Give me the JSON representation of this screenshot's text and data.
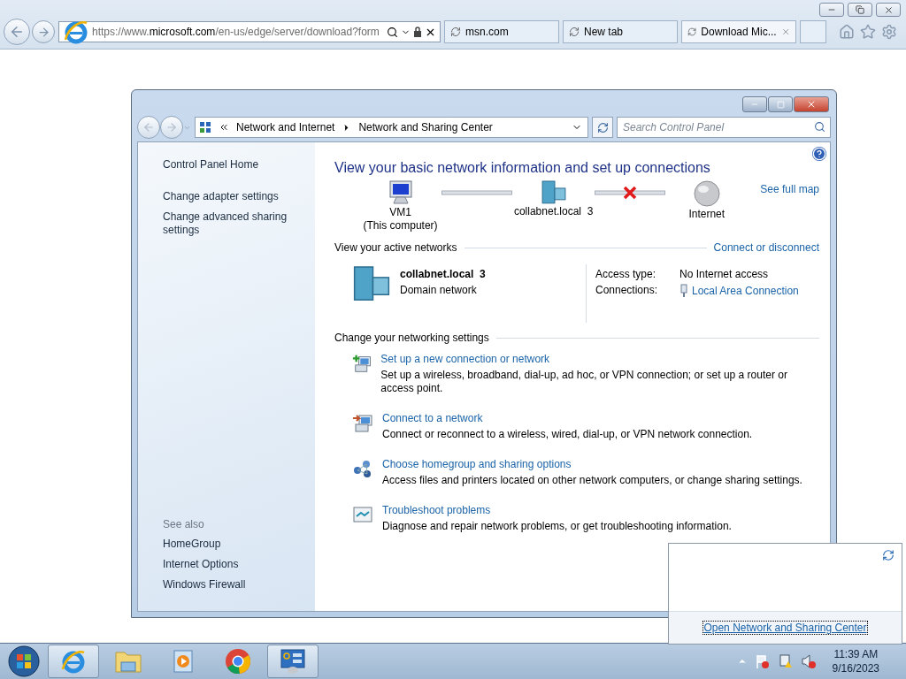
{
  "browser": {
    "address": {
      "prefix": "https://www.",
      "domain": "microsoft.com",
      "path": "/en-us/edge/server/download?form"
    },
    "tabs": [
      {
        "label": "msn.com",
        "selected": false,
        "closable": false
      },
      {
        "label": "New tab",
        "selected": false,
        "closable": false
      },
      {
        "label": "Download Mic...",
        "selected": true,
        "closable": true
      }
    ]
  },
  "window": {
    "breadcrumb": [
      "Network and Internet",
      "Network and Sharing Center"
    ],
    "search": {
      "placeholder": "Search Control Panel"
    },
    "sidebar": {
      "links": [
        "Control Panel Home",
        "Change adapter settings",
        "Change advanced sharing settings"
      ],
      "see_also_heading": "See also",
      "see_also": [
        "HomeGroup",
        "Internet Options",
        "Windows Firewall"
      ]
    },
    "heading": "View your basic network information and set up connections",
    "map": {
      "nodes": [
        {
          "kind": "computer",
          "label": "VM1",
          "sublabel": "(This computer)"
        },
        {
          "kind": "network",
          "label": "collabnet.local  3"
        },
        {
          "kind": "internet",
          "label": "Internet"
        }
      ],
      "links": [
        {
          "broken": false
        },
        {
          "broken": true
        }
      ],
      "full_map_link": "See full map"
    },
    "active_networks": {
      "heading": "View your active networks",
      "link": "Connect or disconnect",
      "networks": [
        {
          "name": "collabnet.local  3",
          "type": "Domain network",
          "access_label": "Access type:",
          "access": "No Internet access",
          "connections_label": "Connections:",
          "connection": "Local Area Connection"
        }
      ]
    },
    "settings": {
      "heading": "Change your networking settings",
      "tasks": [
        {
          "kind": "new-connection",
          "title": "Set up a new connection or network",
          "description": "Set up a wireless, broadband, dial-up, ad hoc, or VPN connection; or set up a router or access point."
        },
        {
          "kind": "connect",
          "title": "Connect to a network",
          "description": "Connect or reconnect to a wireless, wired, dial-up, or VPN network connection."
        },
        {
          "kind": "homegroup",
          "title": "Choose homegroup and sharing options",
          "description": "Access files and printers located on other network computers, or change sharing settings."
        },
        {
          "kind": "troubleshoot",
          "title": "Troubleshoot problems",
          "description": "Diagnose and repair network problems, or get troubleshooting information."
        }
      ]
    }
  },
  "flyout": {
    "link": "Open Network and Sharing Center"
  },
  "taskbar": {
    "apps": [
      {
        "kind": "ie",
        "running": true
      },
      {
        "kind": "explorer",
        "running": false
      },
      {
        "kind": "media",
        "running": false
      },
      {
        "kind": "chrome",
        "running": false
      },
      {
        "kind": "control-panel",
        "running": true
      }
    ],
    "time": "11:39 AM",
    "date": "9/16/2023"
  }
}
